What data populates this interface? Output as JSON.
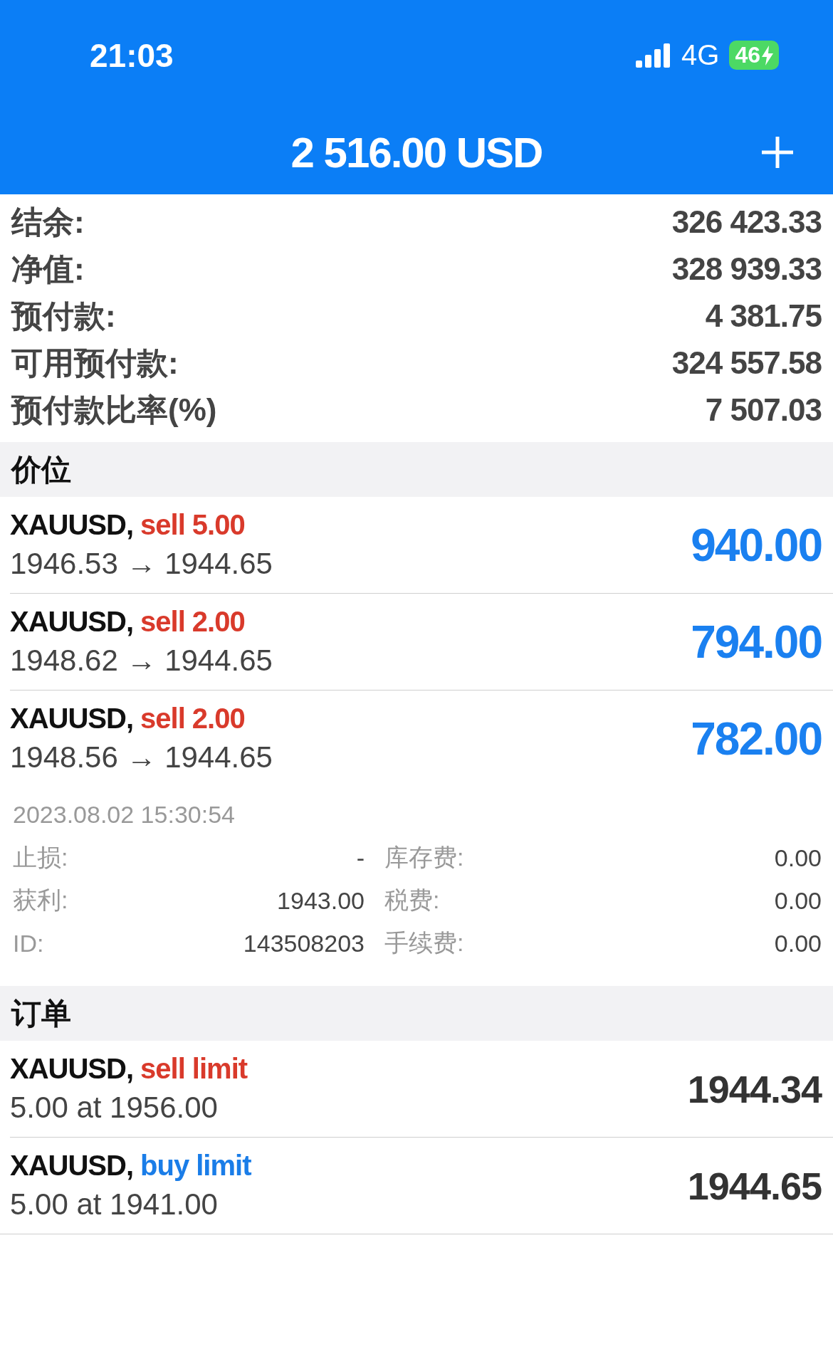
{
  "status_bar": {
    "time": "21:03",
    "network": "4G",
    "battery": "46"
  },
  "header": {
    "title": "2 516.00 USD"
  },
  "summary": [
    {
      "label": "结余:",
      "value": "326 423.33"
    },
    {
      "label": "净值:",
      "value": "328 939.33"
    },
    {
      "label": "预付款:",
      "value": "4 381.75"
    },
    {
      "label": "可用预付款:",
      "value": "324 557.58"
    },
    {
      "label": "预付款比率(%)",
      "value": "7 507.03"
    }
  ],
  "positions": {
    "title": "价位",
    "items": [
      {
        "symbol": "XAUUSD,",
        "kind": "sell",
        "trade": "sell 5.00",
        "prices": "1946.53 → 1944.65",
        "profit": "940.00",
        "expanded": false
      },
      {
        "symbol": "XAUUSD,",
        "kind": "sell",
        "trade": "sell 2.00",
        "prices": "1948.62 → 1944.65",
        "profit": "794.00",
        "expanded": false
      },
      {
        "symbol": "XAUUSD,",
        "kind": "sell",
        "trade": "sell 2.00",
        "prices": "1948.56 → 1944.65",
        "profit": "782.00",
        "expanded": true,
        "details": {
          "time": "2023.08.02 15:30:54",
          "columns": [
            [
              {
                "label": "止损:",
                "value": "-"
              },
              {
                "label": "获利:",
                "value": "1943.00"
              },
              {
                "label": "ID:",
                "value": "143508203"
              }
            ],
            [
              {
                "label": "库存费:",
                "value": "0.00"
              },
              {
                "label": "税费:",
                "value": "0.00"
              },
              {
                "label": "手续费:",
                "value": "0.00"
              }
            ]
          ]
        }
      }
    ]
  },
  "orders": {
    "title": "订单",
    "items": [
      {
        "symbol": "XAUUSD,",
        "kind": "sell",
        "trade": "sell limit",
        "line": "5.00 at 1956.00",
        "price": "1944.34"
      },
      {
        "symbol": "XAUUSD,",
        "kind": "buy",
        "trade": "buy limit",
        "line": "5.00 at 1941.00",
        "price": "1944.65"
      }
    ]
  }
}
